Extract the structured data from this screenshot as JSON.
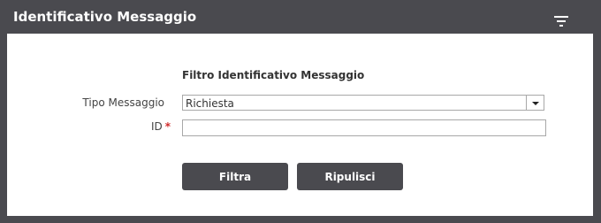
{
  "panel": {
    "title": "Identificativo Messaggio",
    "filter_icon": "filter-list-icon"
  },
  "form": {
    "section_title": "Filtro Identificativo Messaggio",
    "tipo_messaggio": {
      "label": "Tipo Messaggio",
      "selected": "Richiesta"
    },
    "id": {
      "label": "ID",
      "required_marker": "*",
      "value": ""
    }
  },
  "buttons": {
    "filtra": "Filtra",
    "ripulisci": "Ripulisci"
  },
  "colors": {
    "header_bg": "#4a4a4f",
    "button_bg": "#4a4a4f",
    "required": "#d12b2b"
  }
}
